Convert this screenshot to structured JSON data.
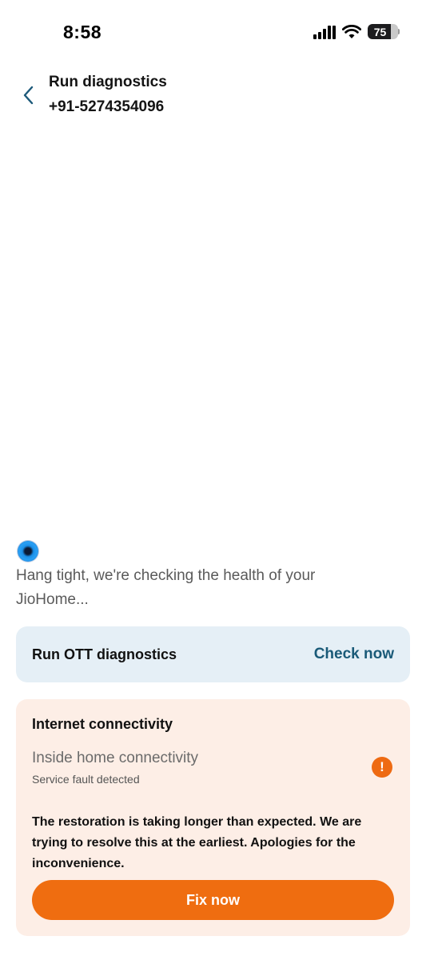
{
  "status_bar": {
    "time": "8:58",
    "battery": "75",
    "icons": [
      "signal-icon",
      "wifi-icon",
      "battery-icon"
    ]
  },
  "header": {
    "title": "Run diagnostics",
    "phone": "+91-5274354096",
    "back_icon": "chevron-left-icon"
  },
  "loader": {
    "message": "Hang tight, we're checking the health of your JioHome..."
  },
  "ott_card": {
    "title": "Run OTT diagnostics",
    "action": "Check now",
    "bg_color": "#e5eff6"
  },
  "internet_card": {
    "title": "Internet connectivity",
    "subtitle": "Inside home connectivity",
    "status": "Service fault detected",
    "status_icon": "alert-icon",
    "message": "The restoration is taking longer than expected. We are trying to resolve this at the earliest. Apologies for the inconvenience.",
    "button_label": "Fix now",
    "accent_color": "#ef6d10",
    "bg_color": "#fdeee6"
  }
}
